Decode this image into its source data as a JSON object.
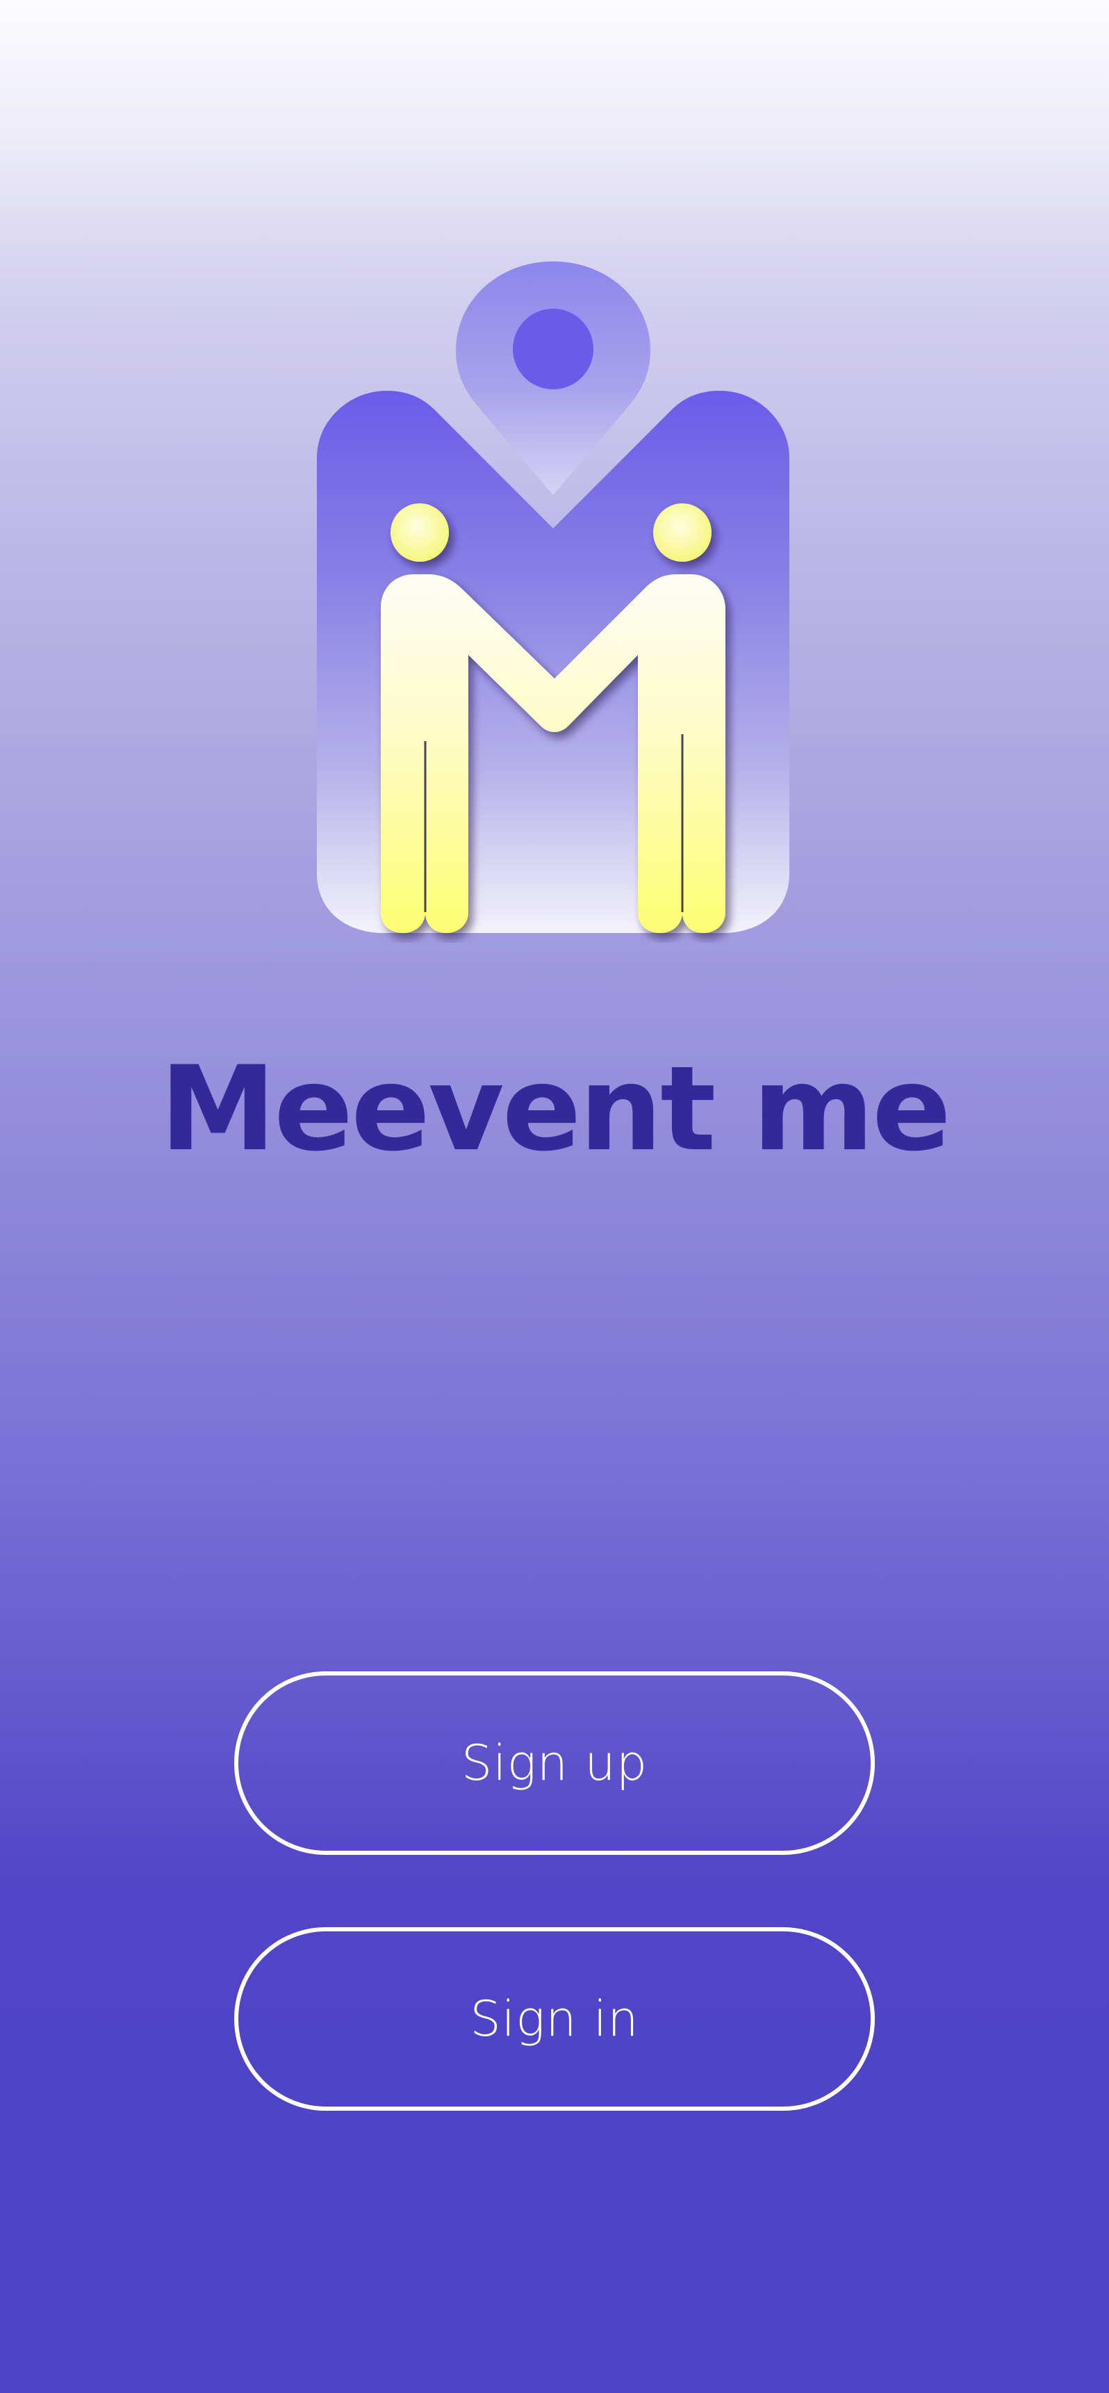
{
  "app": {
    "title": "Meevent me"
  },
  "actions": {
    "signup_label": "Sign up",
    "signin_label": "Sign in"
  },
  "logo": {
    "icon": "meetup-people-pin-logo",
    "colors": {
      "purple": "#6a5ce8",
      "yellow": "#fdfd78",
      "cream": "#fdfdf4"
    }
  },
  "colors": {
    "title": "#35289a",
    "background_top": "#fcfcfe",
    "background_bottom": "#4f44c6",
    "button_border": "#ffffff",
    "button_text": "#ffffff"
  }
}
